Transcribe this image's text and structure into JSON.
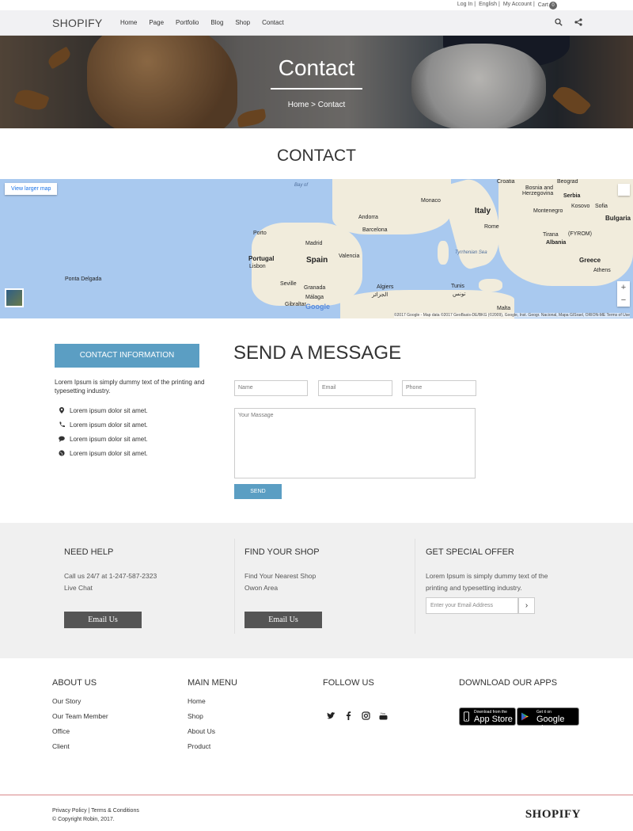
{
  "topbar": {
    "login": "Log In |",
    "language": "English |",
    "account": "My Account |",
    "cart": "Cart",
    "cart_count": "0"
  },
  "nav": {
    "logo": "SHOPIFY",
    "items": [
      "Home",
      "Page",
      "Portfolio",
      "Blog",
      "Shop",
      "Contact"
    ],
    "icons": [
      "search-icon",
      "share-icon"
    ]
  },
  "hero": {
    "title": "Contact",
    "breadcrumb": "Home > Contact"
  },
  "contact_title": "CONTACT",
  "map": {
    "larger_map": "View larger map",
    "labels": {
      "croatia": "Croatia",
      "beograd": "Beograd",
      "bosnia": "Bosnia and",
      "herzegovina": "Herzegovina",
      "serbia": "Serbia",
      "montenegro": "Montenegro",
      "kosovo": "Kosovo",
      "sofia": "Sofia",
      "bulgaria": "Bulgaria",
      "italy": "Italy",
      "fyrom": "(FYROM)",
      "tirana": "Tirana",
      "albania": "Albania",
      "rome": "Rome",
      "monaco": "Monaco",
      "andorra": "Andorra",
      "barcelona": "Barcelona",
      "porto": "Porto",
      "madrid": "Madrid",
      "portugal": "Portugal",
      "lisbon": "Lisbon",
      "spain": "Spain",
      "valencia": "Valencia",
      "seville": "Seville",
      "granada": "Granada",
      "malaga": "Málaga",
      "gibraltar": "Gibraltar",
      "algiers": "Algiers",
      "algiers_ar": "الجزائر",
      "tunis": "Tunis",
      "tunis_ar": "تونس",
      "malta": "Malta",
      "greece": "Greece",
      "athens": "Athens",
      "ponta": "Ponta Delgada",
      "tyrrhenian": "Tyrrhenian Sea",
      "biscay": "Bay of"
    },
    "google": "Google",
    "attribution": "©2017 Google - Map data ©2017 GeoBasis-DE/BKG (©2009), Google, Inst. Geogr. Nacional, Mapa GISrael, ORION-ME   Terms of Use",
    "zoom_in": "+",
    "zoom_out": "−"
  },
  "contact_info": {
    "title": "CONTACT INFORMATION",
    "text": "Lorem Ipsum is simply dummy text of the printing and typesetting industry.",
    "items": [
      {
        "icon": "map-marker-icon",
        "text": "Lorem ipsum dolor sit amet."
      },
      {
        "icon": "phone-icon",
        "text": "Lorem ipsum dolor sit amet."
      },
      {
        "icon": "chat-icon",
        "text": "Lorem ipsum dolor sit amet."
      },
      {
        "icon": "globe-icon",
        "text": "Lorem ipsum dolor sit amet."
      }
    ]
  },
  "message": {
    "title": "SEND A MESSAGE",
    "name_placeholder": "Name",
    "email_placeholder": "Email",
    "phone_placeholder": "Phone",
    "message_placeholder": "Your Massage",
    "send": "SEND"
  },
  "help": {
    "need": {
      "title": "NEED HELP",
      "line1": "Call us 24/7 at 1-247-587-2323",
      "line2": "Live Chat",
      "button": "Email Us"
    },
    "shop": {
      "title": "FIND YOUR SHOP",
      "line1": "Find Your Nearest Shop",
      "line2": "Owon Area",
      "button": "Email Us"
    },
    "offer": {
      "title": "GET SPECIAL OFFER",
      "line1": "Lorem Ipsum is simply dummy text of the",
      "line2": "printing and typesetting industry.",
      "email_placeholder": "Enter your Email Address",
      "go": "›"
    }
  },
  "footer": {
    "about": {
      "title": "ABOUT US",
      "links": [
        "Our Story",
        "Our Team Member",
        "Office",
        "Client"
      ]
    },
    "menu": {
      "title": "MAIN MENU",
      "links": [
        "Home",
        "Shop",
        "About Us",
        "Product"
      ]
    },
    "follow": {
      "title": "FOLLOW US",
      "icons": [
        "twitter-icon",
        "facebook-icon",
        "instagram-icon",
        "youtube-icon"
      ]
    },
    "apps": {
      "title": "DOWNLOAD OUR APPS",
      "appstore_small": "Download from the",
      "appstore": "App Store",
      "googleplay_small": "Get it on",
      "googleplay": "Google play"
    },
    "policy": "Privacy Policy | Terms & Conditions",
    "copyright": "© Copyright Robin, 2017.",
    "logo": "SHOPIFY"
  }
}
